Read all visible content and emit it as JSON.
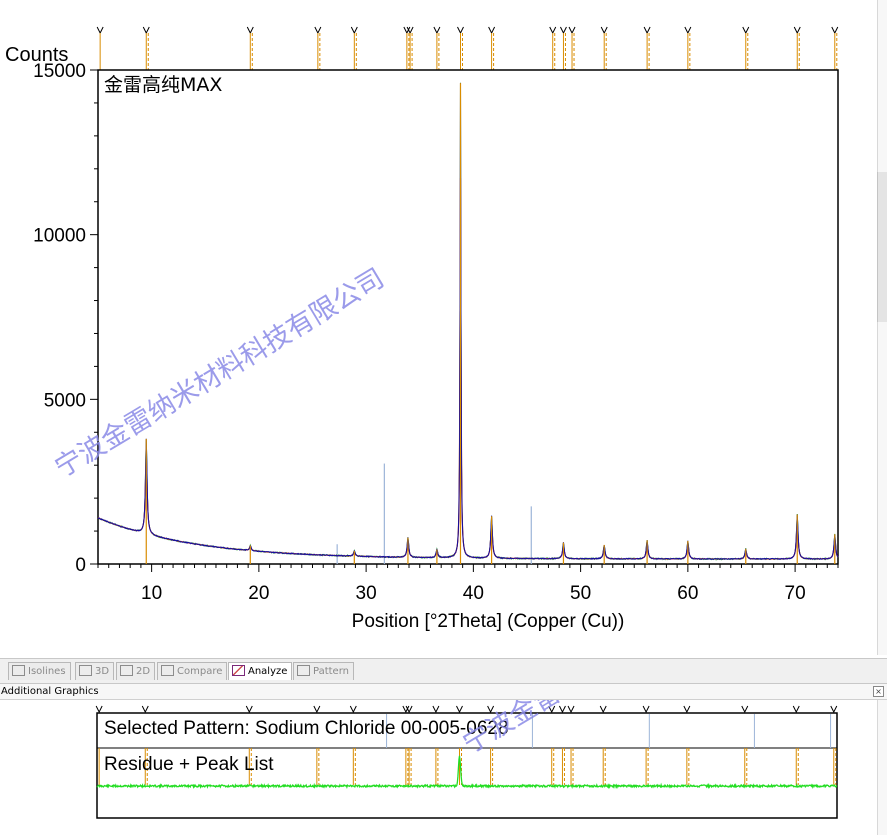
{
  "chart_data": {
    "type": "line",
    "title": "金雷高纯MAX",
    "ylabel": "Counts",
    "xlabel": "Position [°2Theta] (Copper (Cu))",
    "xlim": [
      5,
      74
    ],
    "ylim": [
      0,
      15000
    ],
    "x_ticks": [
      10,
      20,
      30,
      40,
      50,
      60,
      70
    ],
    "y_ticks": [
      0,
      5000,
      10000,
      15000
    ],
    "background_start": 1400,
    "background_end": 150,
    "peaks": [
      {
        "x": 9.5,
        "y": 3800
      },
      {
        "x": 19.2,
        "y": 560
      },
      {
        "x": 28.9,
        "y": 400
      },
      {
        "x": 33.9,
        "y": 800
      },
      {
        "x": 36.6,
        "y": 440
      },
      {
        "x": 38.8,
        "y": 14600
      },
      {
        "x": 41.7,
        "y": 1450
      },
      {
        "x": 48.4,
        "y": 650
      },
      {
        "x": 52.2,
        "y": 580
      },
      {
        "x": 56.2,
        "y": 720
      },
      {
        "x": 60.0,
        "y": 700
      },
      {
        "x": 65.4,
        "y": 460
      },
      {
        "x": 70.2,
        "y": 1500
      },
      {
        "x": 73.7,
        "y": 900
      }
    ],
    "reference_markers_top": [
      5.2,
      9.5,
      19.2,
      25.5,
      28.9,
      33.8,
      34.1,
      36.6,
      38.8,
      41.7,
      47.4,
      48.4,
      49.2,
      52.2,
      56.2,
      60.0,
      65.4,
      70.2,
      73.7
    ],
    "reference_sticks_blue": [
      {
        "x": 31.7,
        "y": 3050
      },
      {
        "x": 45.4,
        "y": 1750
      },
      {
        "x": 27.3,
        "y": 600
      }
    ],
    "colors": {
      "reference_line": "#d98c00",
      "measured": "#1010a0",
      "calculated": "#e0201a",
      "difference": "#30a030",
      "stick": "#9cb4d8",
      "residue": "#22dd22"
    }
  },
  "watermark": {
    "text": "宁波金雷纳米材料科技有限公司"
  },
  "tabs": [
    {
      "label": "Isolines"
    },
    {
      "label": "3D"
    },
    {
      "label": "2D"
    },
    {
      "label": "Compare"
    },
    {
      "label": "Analyze"
    },
    {
      "label": "Pattern"
    }
  ],
  "panel": {
    "title": "Additional Graphics",
    "selected_pattern": "Selected Pattern: Sodium Chloride  00-005-0628",
    "residue_label": "Residue + Peak List",
    "sticks_x": [
      32.0,
      45.6,
      56.5,
      66.3,
      73.4
    ]
  }
}
